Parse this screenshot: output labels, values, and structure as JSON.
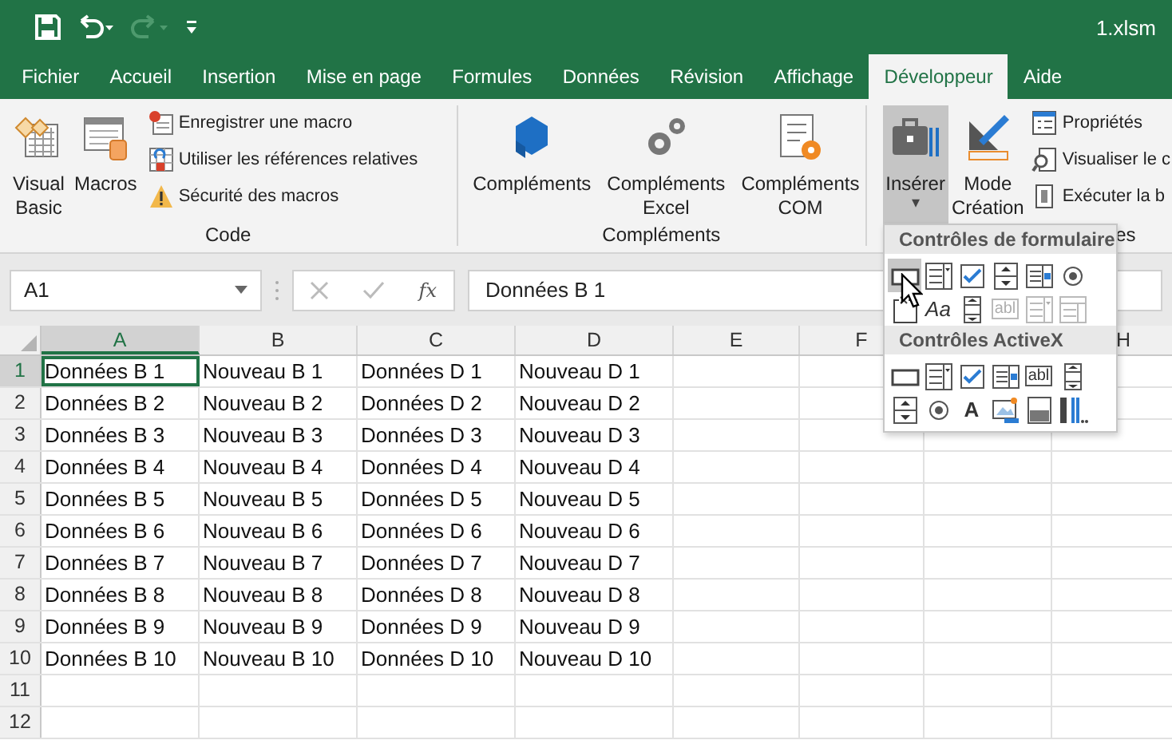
{
  "window": {
    "title": "1.xlsm"
  },
  "quick_access": [
    {
      "kind": "save",
      "disabled": false
    },
    {
      "kind": "undo",
      "disabled": false
    },
    {
      "kind": "redo",
      "disabled": true
    },
    {
      "kind": "customize",
      "disabled": false
    }
  ],
  "tabs": [
    {
      "label": "Fichier",
      "selected": false
    },
    {
      "label": "Accueil",
      "selected": false
    },
    {
      "label": "Insertion",
      "selected": false
    },
    {
      "label": "Mise en page",
      "selected": false
    },
    {
      "label": "Formules",
      "selected": false
    },
    {
      "label": "Données",
      "selected": false
    },
    {
      "label": "Révision",
      "selected": false
    },
    {
      "label": "Affichage",
      "selected": false
    },
    {
      "label": "Développeur",
      "selected": true
    },
    {
      "label": "Aide",
      "selected": false
    }
  ],
  "ribbon": {
    "groups": [
      {
        "label": "Code",
        "large": [
          {
            "kind": "vb",
            "label": "Visual\nBasic",
            "pressed": false
          },
          {
            "kind": "macros",
            "label": "Macros",
            "pressed": false
          }
        ],
        "small": [
          {
            "kind": "record",
            "label": "Enregistrer une macro"
          },
          {
            "kind": "relative",
            "label": "Utiliser les références relatives"
          },
          {
            "kind": "security",
            "label": "Sécurité des macros"
          }
        ]
      },
      {
        "label": "Compléments",
        "large": [
          {
            "kind": "addins",
            "label": "Compléments",
            "pressed": false
          },
          {
            "kind": "excel-addins",
            "label": "Compléments\nExcel",
            "pressed": false
          },
          {
            "kind": "com-addins",
            "label": "Compléments\nCOM",
            "pressed": false
          }
        ]
      },
      {
        "label": "es",
        "large": [
          {
            "kind": "insert",
            "label": "Insérer",
            "pressed": true,
            "caret": "▾"
          },
          {
            "kind": "design",
            "label": "Mode\nCréation",
            "pressed": false
          }
        ],
        "small": [
          {
            "kind": "properties",
            "label": "Propriétés"
          },
          {
            "kind": "view-code",
            "label": "Visualiser le c"
          },
          {
            "kind": "run-dialog",
            "label": "Exécuter la b"
          }
        ]
      }
    ]
  },
  "formula_bar": {
    "name_box": "A1",
    "fx": "fx",
    "value": "Données B 1"
  },
  "sheet": {
    "columns": [
      {
        "label": "A",
        "selected": true
      },
      {
        "label": "B",
        "selected": false
      },
      {
        "label": "C",
        "selected": false
      },
      {
        "label": "D",
        "selected": false
      },
      {
        "label": "E",
        "selected": false
      },
      {
        "label": "F",
        "selected": false
      },
      {},
      {
        "label": "H",
        "selected": false
      }
    ],
    "rows": [
      {
        "number": "1",
        "selected": true,
        "cells": [
          "Données B 1",
          "Nouveau B 1",
          "Données D 1",
          "Nouveau D 1"
        ]
      },
      {
        "number": "2",
        "selected": false,
        "cells": [
          "Données B 2",
          "Nouveau B 2",
          "Données D 2",
          "Nouveau D 2"
        ]
      },
      {
        "number": "3",
        "selected": false,
        "cells": [
          "Données B 3",
          "Nouveau B 3",
          "Données D 3",
          "Nouveau D 3"
        ]
      },
      {
        "number": "4",
        "selected": false,
        "cells": [
          "Données B 4",
          "Nouveau B 4",
          "Données D 4",
          "Nouveau D 4"
        ]
      },
      {
        "number": "5",
        "selected": false,
        "cells": [
          "Données B 5",
          "Nouveau B 5",
          "Données D 5",
          "Nouveau D 5"
        ]
      },
      {
        "number": "6",
        "selected": false,
        "cells": [
          "Données B 6",
          "Nouveau B 6",
          "Données D 6",
          "Nouveau D 6"
        ]
      },
      {
        "number": "7",
        "selected": false,
        "cells": [
          "Données B 7",
          "Nouveau B 7",
          "Données D 7",
          "Nouveau D 7"
        ]
      },
      {
        "number": "8",
        "selected": false,
        "cells": [
          "Données B 8",
          "Nouveau B 8",
          "Données D 8",
          "Nouveau D 8"
        ]
      },
      {
        "number": "9",
        "selected": false,
        "cells": [
          "Données B 9",
          "Nouveau B 9",
          "Données D 9",
          "Nouveau D 9"
        ]
      },
      {
        "number": "10",
        "selected": false,
        "cells": [
          "Données B 10",
          "Nouveau B 10",
          "Données D 10",
          "Nouveau D 10"
        ]
      },
      {
        "number": "11",
        "selected": false,
        "cells": []
      },
      {
        "number": "12",
        "selected": false,
        "cells": []
      }
    ]
  },
  "insert_menu": {
    "sections": [
      {
        "title": "Contrôles de formulaire",
        "items": [
          {
            "kind": "button",
            "highlighted": true,
            "disabled": false
          },
          {
            "kind": "combo",
            "highlighted": false,
            "disabled": false
          },
          {
            "kind": "checkbox",
            "highlighted": false,
            "disabled": false
          },
          {
            "kind": "spin",
            "highlighted": false,
            "disabled": false
          },
          {
            "kind": "listbox",
            "highlighted": false,
            "disabled": false
          },
          {
            "kind": "option",
            "highlighted": false,
            "disabled": false
          },
          {
            "kind": "groupbox",
            "highlighted": false,
            "disabled": false
          },
          {
            "kind": "label",
            "glyph": "Aa",
            "highlighted": false,
            "disabled": false
          },
          {
            "kind": "scrollbar",
            "highlighted": false,
            "disabled": false
          },
          {
            "kind": "textfield",
            "glyph": "abl",
            "highlighted": false,
            "disabled": true
          },
          {
            "kind": "combo",
            "highlighted": false,
            "disabled": true
          },
          {
            "kind": "combolist",
            "highlighted": false,
            "disabled": true
          }
        ]
      },
      {
        "title": "Contrôles ActiveX",
        "items": [
          {
            "kind": "button",
            "highlighted": false,
            "disabled": false
          },
          {
            "kind": "combo",
            "highlighted": false,
            "disabled": false
          },
          {
            "kind": "checkbox",
            "highlighted": false,
            "disabled": false
          },
          {
            "kind": "listbox",
            "highlighted": false,
            "disabled": false
          },
          {
            "kind": "textfield",
            "glyph": "abl",
            "highlighted": false,
            "disabled": false
          },
          {
            "kind": "scrollbar",
            "highlighted": false,
            "disabled": false
          },
          {
            "kind": "spin",
            "highlighted": false,
            "disabled": false
          },
          {
            "kind": "option",
            "highlighted": false,
            "disabled": false
          },
          {
            "kind": "label",
            "glyph": "A",
            "highlighted": false,
            "disabled": false
          },
          {
            "kind": "image",
            "highlighted": false,
            "disabled": false
          },
          {
            "kind": "toggle",
            "highlighted": false,
            "disabled": false
          },
          {
            "kind": "more",
            "highlighted": false,
            "disabled": false
          }
        ]
      }
    ]
  }
}
